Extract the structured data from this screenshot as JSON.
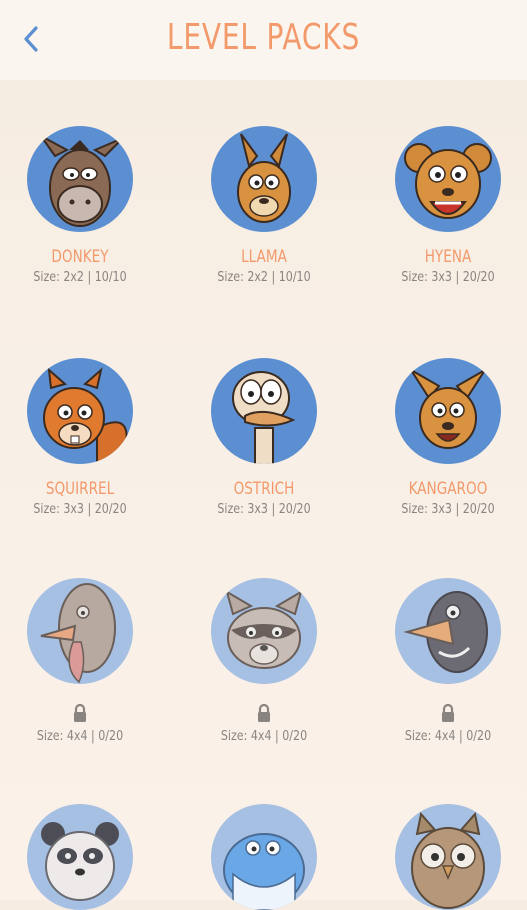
{
  "header": {
    "title": "LEVEL PACKS",
    "back_icon": "chevron-left-icon"
  },
  "colors": {
    "accent": "#f29a6c",
    "avatar_unlocked": "#5c8fd1",
    "avatar_locked": "#a6c0e3",
    "text_muted": "#8a8480"
  },
  "packs": [
    {
      "name": "DONKEY",
      "size": "Size: 2x2  |  10/10",
      "locked": false,
      "icon": "donkey-icon"
    },
    {
      "name": "LLAMA",
      "size": "Size: 2x2  |  10/10",
      "locked": false,
      "icon": "llama-icon"
    },
    {
      "name": "HYENA",
      "size": "Size: 3x3  |  20/20",
      "locked": false,
      "icon": "hyena-icon"
    },
    {
      "name": "SQUIRREL",
      "size": "Size: 3x3  |  20/20",
      "locked": false,
      "icon": "squirrel-icon"
    },
    {
      "name": "OSTRICH",
      "size": "Size: 3x3  |  20/20",
      "locked": false,
      "icon": "ostrich-icon"
    },
    {
      "name": "KANGAROO",
      "size": "Size: 3x3  |  20/20",
      "locked": false,
      "icon": "kangaroo-icon"
    },
    {
      "name": "",
      "size": "Size: 4x4  |  0/20",
      "locked": true,
      "icon": "turkey-icon"
    },
    {
      "name": "",
      "size": "Size: 4x4  |  0/20",
      "locked": true,
      "icon": "raccoon-icon"
    },
    {
      "name": "",
      "size": "Size: 4x4  |  0/20",
      "locked": true,
      "icon": "crow-icon"
    },
    {
      "name": "",
      "size": "",
      "locked": true,
      "icon": "panda-icon"
    },
    {
      "name": "",
      "size": "",
      "locked": true,
      "icon": "whale-icon"
    },
    {
      "name": "",
      "size": "",
      "locked": true,
      "icon": "owl-icon"
    }
  ]
}
